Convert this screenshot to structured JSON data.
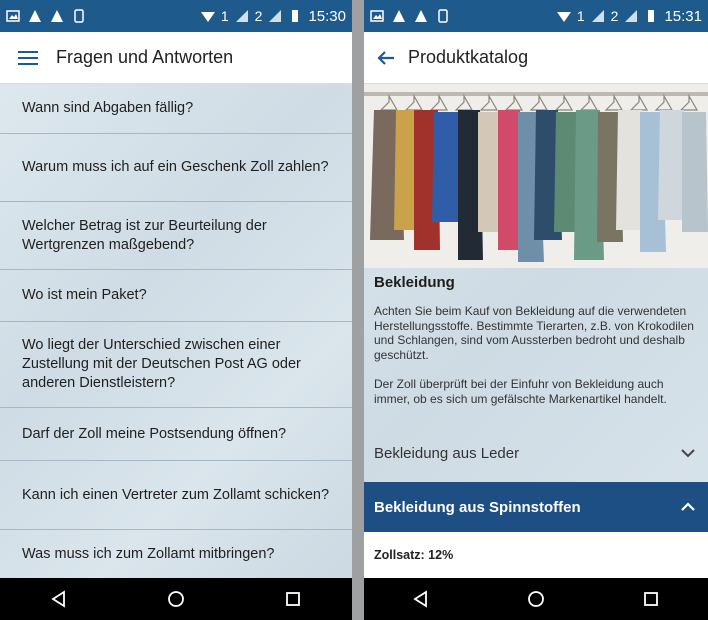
{
  "left_screen": {
    "status_bar": {
      "time": "15:30",
      "sim1": "1",
      "sim2": "2"
    },
    "app_bar": {
      "title": "Fragen und Antworten"
    },
    "faq_items": [
      "Wann sind Abgaben fällig?",
      "Warum muss ich auf ein Geschenk Zoll zahlen?",
      "Welcher Betrag ist zur Beurteilung der Wertgrenzen maßgebend?",
      "Wo ist mein Paket?",
      "Wo liegt der Unterschied zwischen einer Zustellung mit der Deutschen Post AG oder anderen Dienstleistern?",
      "Darf der Zoll meine Postsendung öffnen?",
      "Kann ich einen Vertreter zum Zollamt schicken?",
      "Was muss ich zum Zollamt mitbringen?"
    ]
  },
  "right_screen": {
    "status_bar": {
      "time": "15:31",
      "sim1": "1",
      "sim2": "2"
    },
    "app_bar": {
      "title": "Produktkatalog"
    },
    "section": {
      "title": "Bekleidung",
      "paragraph1": "Achten Sie beim Kauf von Bekleidung auf die verwendeten Herstellungsstoffe. Bestimmte Tierarten, z.B. von Krokodilen und Schlangen, sind vom Aussterben bedroht und deshalb geschützt.",
      "paragraph2": "Der Zoll überprüft bei der Einfuhr von Bekleidung auch immer, ob es sich um gefälschte Markenartikel handelt."
    },
    "accordion": [
      {
        "label": "Bekleidung aus Leder",
        "expanded": false
      },
      {
        "label": "Bekleidung aus Spinnstoffen",
        "expanded": true
      }
    ],
    "rate": "Zollsatz: 12%"
  },
  "colors": {
    "status_bar": "#1f5a8c",
    "accent": "#1d4f84",
    "list_divider": "#a6b8c6"
  }
}
